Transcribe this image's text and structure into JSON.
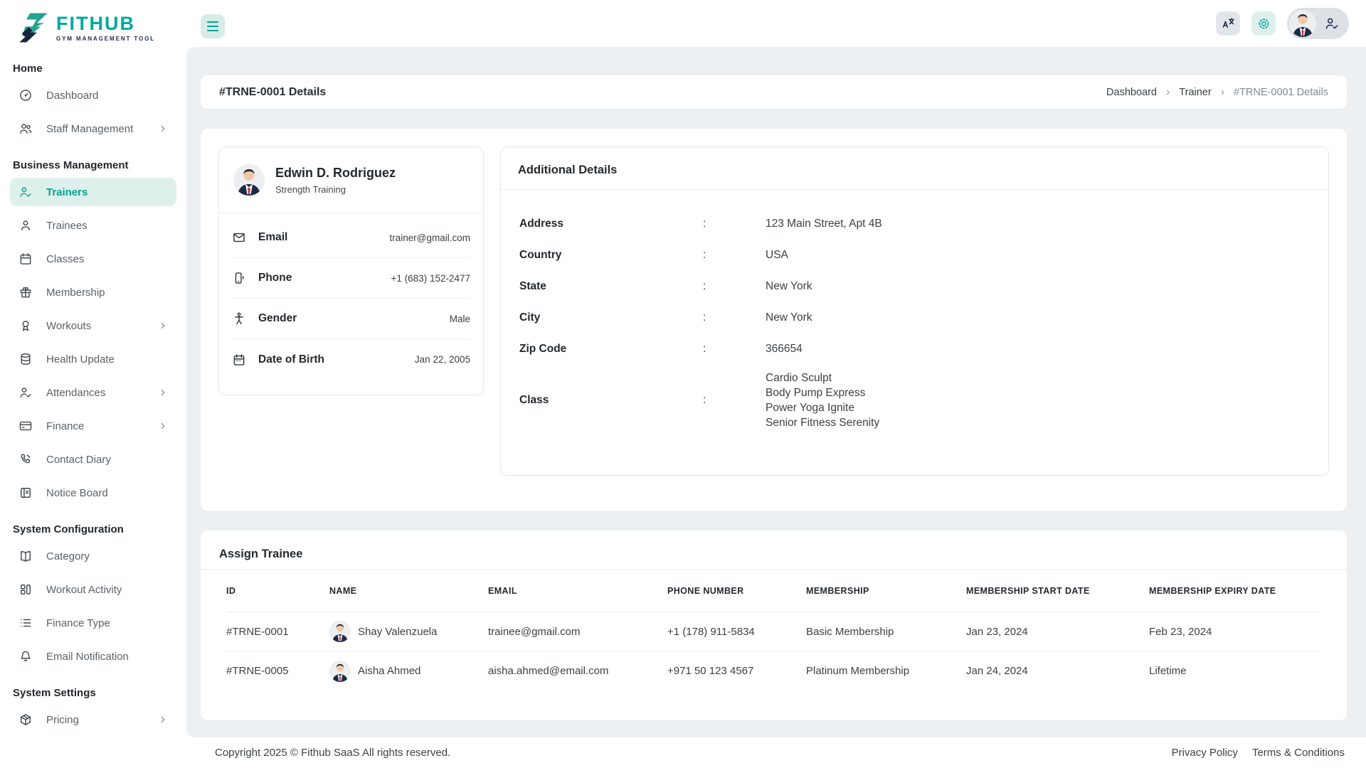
{
  "colors": {
    "accent": "#00a89c",
    "accent_light_bg": "#def0ec",
    "navy": "#1d2b4a",
    "content_bg": "#edf0f3"
  },
  "brand": {
    "name": "FITHUB",
    "tagline": "GYM MANAGEMENT TOOL"
  },
  "sidebar": {
    "sections": [
      {
        "title": "Home",
        "items": [
          {
            "label": "Dashboard"
          },
          {
            "label": "Staff Management"
          }
        ]
      },
      {
        "title": "Business Management",
        "items": [
          {
            "label": "Trainers"
          },
          {
            "label": "Trainees"
          },
          {
            "label": "Classes"
          },
          {
            "label": "Membership"
          },
          {
            "label": "Workouts"
          },
          {
            "label": "Health Update"
          },
          {
            "label": "Attendances"
          },
          {
            "label": "Finance"
          },
          {
            "label": "Contact Diary"
          },
          {
            "label": "Notice Board"
          }
        ]
      },
      {
        "title": "System Configuration",
        "items": [
          {
            "label": "Category"
          },
          {
            "label": "Workout Activity"
          },
          {
            "label": "Finance Type"
          },
          {
            "label": "Email Notification"
          }
        ]
      },
      {
        "title": "System Settings",
        "items": [
          {
            "label": "Pricing"
          }
        ]
      }
    ]
  },
  "page": {
    "title": "#TRNE-0001 Details",
    "breadcrumb": [
      "Dashboard",
      "Trainer",
      "#TRNE-0001 Details"
    ],
    "breadcrumb_sep": "›"
  },
  "profile": {
    "name": "Edwin D. Rodriguez",
    "specialty": "Strength Training",
    "rows": [
      {
        "label": "Email",
        "value": "trainer@gmail.com"
      },
      {
        "label": "Phone",
        "value": "+1 (683) 152-2477"
      },
      {
        "label": "Gender",
        "value": "Male"
      },
      {
        "label": "Date of Birth",
        "value": "Jan 22, 2005"
      }
    ]
  },
  "additional": {
    "title": "Additional Details",
    "colon": ":",
    "rows": [
      {
        "label": "Address",
        "value": "123 Main Street, Apt 4B"
      },
      {
        "label": "Country",
        "value": "USA"
      },
      {
        "label": "State",
        "value": "New York"
      },
      {
        "label": "City",
        "value": "New York"
      },
      {
        "label": "Zip Code",
        "value": "366654"
      }
    ],
    "class_row": {
      "label": "Class",
      "values": [
        "Cardio Sculpt",
        "Body Pump Express",
        "Power Yoga Ignite",
        "Senior Fitness Serenity"
      ]
    }
  },
  "assign": {
    "title": "Assign Trainee",
    "columns": [
      "ID",
      "NAME",
      "EMAIL",
      "PHONE NUMBER",
      "MEMBERSHIP",
      "MEMBERSHIP START DATE",
      "MEMBERSHIP EXPIRY DATE"
    ],
    "rows": [
      {
        "id": "#TRNE-0001",
        "name": "Shay Valenzuela",
        "email": "trainee@gmail.com",
        "phone": "+1 (178) 911-5834",
        "membership": "Basic Membership",
        "start": "Jan 23, 2024",
        "expiry": "Feb 23, 2024"
      },
      {
        "id": "#TRNE-0005",
        "name": "Aisha Ahmed",
        "email": "aisha.ahmed@email.com",
        "phone": "+971 50 123 4567",
        "membership": "Platinum Membership",
        "start": "Jan 24, 2024",
        "expiry": "Lifetime"
      }
    ]
  },
  "footer": {
    "copyright": "Copyright 2025 © Fithub SaaS All rights reserved.",
    "links": [
      "Privacy Policy",
      "Terms & Conditions"
    ]
  }
}
